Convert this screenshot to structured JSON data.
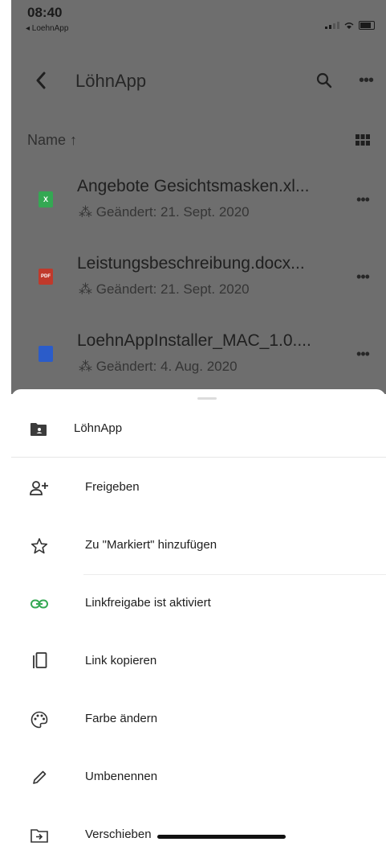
{
  "status_bar": {
    "time": "08:40",
    "back_app": "◂ LoehnApp"
  },
  "header": {
    "title": "LöhnApp",
    "back_icon": "chevron-left-icon",
    "search_icon": "search-icon",
    "more_icon": "more-horizontal-icon"
  },
  "sort": {
    "label": "Name ↑",
    "view_icon": "grid-view-icon"
  },
  "files": [
    {
      "name": "Angebote Gesichtsmasken.xl...",
      "meta": "⁂ Geändert: 21. Sept. 2020",
      "type_label": "X",
      "color": "#34a853",
      "icon": "excel-file-icon"
    },
    {
      "name": "Leistungsbeschreibung.docx...",
      "meta": "⁂ Geändert: 21. Sept. 2020",
      "type_label": "PDF",
      "color": "#c0392b",
      "icon": "pdf-file-icon"
    },
    {
      "name": "LoehnAppInstaller_MAC_1.0....",
      "meta": "⁂ Geändert: 4. Aug. 2020",
      "type_label": "",
      "color": "#2b5cc9",
      "icon": "document-file-icon"
    }
  ],
  "sheet": {
    "title": "LöhnApp",
    "title_icon": "shared-folder-icon",
    "items": [
      {
        "label": "Freigeben",
        "icon": "add-person-icon"
      },
      {
        "label": "Zu \"Markiert\" hinzufügen",
        "icon": "star-icon"
      },
      {
        "label": "Linkfreigabe ist aktiviert",
        "icon": "link-icon",
        "icon_color": "#34a853"
      },
      {
        "label": "Link kopieren",
        "icon": "copy-icon"
      },
      {
        "label": "Farbe ändern",
        "icon": "palette-icon"
      },
      {
        "label": "Umbenennen",
        "icon": "pencil-icon"
      },
      {
        "label": "Verschieben",
        "icon": "move-folder-icon"
      }
    ]
  },
  "colors": {
    "overlay_gray": "#6e6e6e",
    "link_green": "#34a853"
  }
}
